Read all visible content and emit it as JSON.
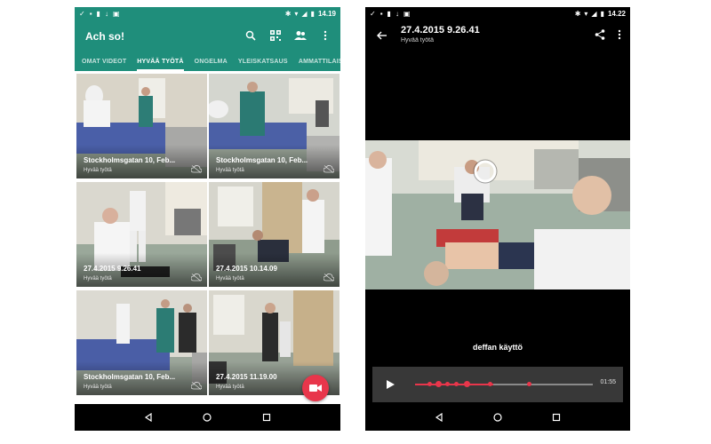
{
  "left_screen": {
    "status_time": "14.19",
    "app_title": "Ach so!",
    "tabs": [
      "OMAT VIDEOT",
      "HYVÄÄ TYÖTÄ",
      "ONGELMA",
      "YLEISKATSAUS",
      "AMMATTILAISEN NI"
    ],
    "active_tab_index": 1,
    "toolbar_icons": [
      "search-icon",
      "qr-code-icon",
      "group-icon",
      "more-vert-icon"
    ],
    "videos": [
      {
        "title": "Stockholmsgatan 10, Feb...",
        "subtitle": "Hyvää työtä"
      },
      {
        "title": "Stockholmsgatan 10, Feb...",
        "subtitle": "Hyvää työtä"
      },
      {
        "title": "27.4.2015 9.26.41",
        "subtitle": "Hyvää työtä"
      },
      {
        "title": "27.4.2015 10.14.09",
        "subtitle": "Hyvää työtä"
      },
      {
        "title": "Stockholmsgatan 10, Feb...",
        "subtitle": "Hyvää työtä"
      },
      {
        "title": "27.4.2015 11.19.00",
        "subtitle": "Hyvää työtä"
      }
    ],
    "fab_icon": "videocam-icon"
  },
  "right_screen": {
    "status_time": "14.22",
    "title": "27.4.2015 9.26.41",
    "subtitle": "Hyvää työtä",
    "annotation_caption": "deffan käyttö",
    "duration": "01:55",
    "progress_fraction": 0.44,
    "annotation_marks": [
      0.08,
      0.13,
      0.18,
      0.23,
      0.29,
      0.42,
      0.64
    ]
  },
  "colors": {
    "accent_teal": "#1f8e7b",
    "accent_red": "#e8364b",
    "player_bg": "#383838"
  }
}
